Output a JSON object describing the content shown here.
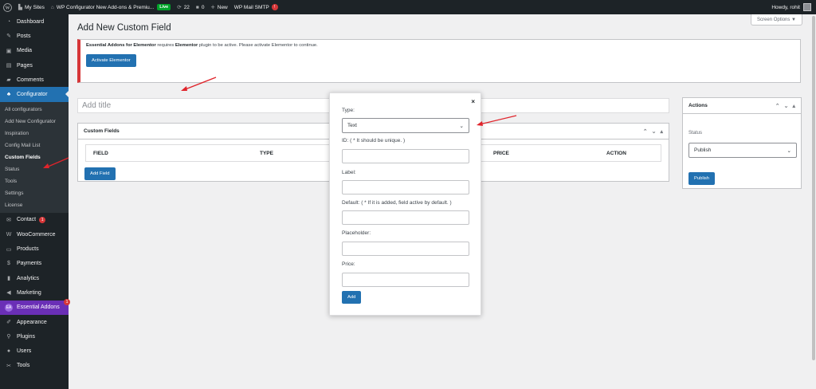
{
  "adminbar": {
    "my_sites": "My Sites",
    "site_name": "WP Configurator New Add-ons & Premiu...",
    "live": "Live",
    "updates": "22",
    "comments": "0",
    "new": "New",
    "smtp": "WP Mail SMTP",
    "smtp_badge": "!",
    "howdy": "Howdy, rohit"
  },
  "sidebar": {
    "top_items": [
      {
        "label": "Dashboard",
        "icon": "dashboard-icon"
      },
      {
        "label": "Posts",
        "icon": "pin-icon"
      },
      {
        "label": "Media",
        "icon": "media-icon"
      },
      {
        "label": "Pages",
        "icon": "pages-icon"
      },
      {
        "label": "Comments",
        "icon": "comment-icon"
      }
    ],
    "configurator": "Configurator",
    "submenu": [
      "All configurators",
      "Add New Configurator",
      "Inspiration",
      "Config Mail List",
      "Custom Fields",
      "Status",
      "Tools",
      "Settings",
      "License"
    ],
    "contact": "Contact",
    "contact_badge": "1",
    "bottom_items": [
      {
        "label": "WooCommerce",
        "icon": "woo-icon"
      },
      {
        "label": "Products",
        "icon": "products-icon"
      },
      {
        "label": "Payments",
        "icon": "payments-icon"
      },
      {
        "label": "Analytics",
        "icon": "analytics-icon"
      },
      {
        "label": "Marketing",
        "icon": "megaphone-icon"
      }
    ],
    "essential_addons": "Essential Addons",
    "essential_badge": "1",
    "last_items": [
      {
        "label": "Appearance",
        "icon": "brush-icon"
      },
      {
        "label": "Plugins",
        "icon": "plugin-icon"
      },
      {
        "label": "Users",
        "icon": "users-icon"
      },
      {
        "label": "Tools",
        "icon": "tools-icon"
      }
    ]
  },
  "page": {
    "screen_options": "Screen Options ▼",
    "title": "Add New Custom Field",
    "notice_bold1": "Essential Addons for Elementor",
    "notice_mid": " requires ",
    "notice_bold2": "Elementor",
    "notice_end": " plugin to be active. Please activate Elementor to continue.",
    "activate_label": "Activate Elementor",
    "title_placeholder": "Add title",
    "custom_fields_heading": "Custom Fields",
    "columns": [
      "FIELD",
      "TYPE",
      "PRICE",
      "ACTION"
    ],
    "add_field_label": "Add Field",
    "actions_heading": "Actions",
    "status_label": "Status",
    "status_value": "Publish",
    "publish_label": "Publish"
  },
  "modal": {
    "close": "×",
    "type_label": "Type:",
    "type_value": "Text",
    "id_label": "ID: ( * It should be unique. )",
    "label_label": "Label:",
    "default_label": "Default: ( * If it is added, field active by default. )",
    "placeholder_label": "Placeholder:",
    "price_label": "Price:",
    "add_label": "Add"
  },
  "colors": {
    "accent": "#2271b1",
    "admin_dark": "#1d2327",
    "annotation_red": "#e0242b",
    "essential_purple": "#6a2fb6"
  }
}
